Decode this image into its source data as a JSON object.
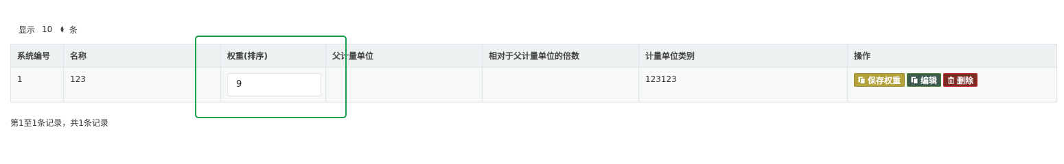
{
  "length_control": {
    "label_prefix": "显示",
    "value": "10",
    "label_suffix": "条"
  },
  "table": {
    "headers": {
      "id": "系统编号",
      "name": "名称",
      "empty": "",
      "weight": "权重(排序)",
      "parent_unit": "父计量单位",
      "multiple": "相对于父计量单位的倍数",
      "category": "计量单位类别",
      "actions": "操作"
    },
    "rows": [
      {
        "id": "1",
        "name": "123",
        "empty": "",
        "weight": "9",
        "parent_unit": "",
        "multiple": "",
        "category": "123123"
      }
    ],
    "buttons": {
      "save_weight": "保存权重",
      "edit": "编辑",
      "delete": "删除"
    }
  },
  "footer": {
    "info": "第1至1条记录，共1条记录"
  },
  "colors": {
    "highlight": "#17a04a",
    "save_button": "#b3a13a",
    "edit_button": "#3e5a4f",
    "delete_button": "#7e2a25"
  }
}
